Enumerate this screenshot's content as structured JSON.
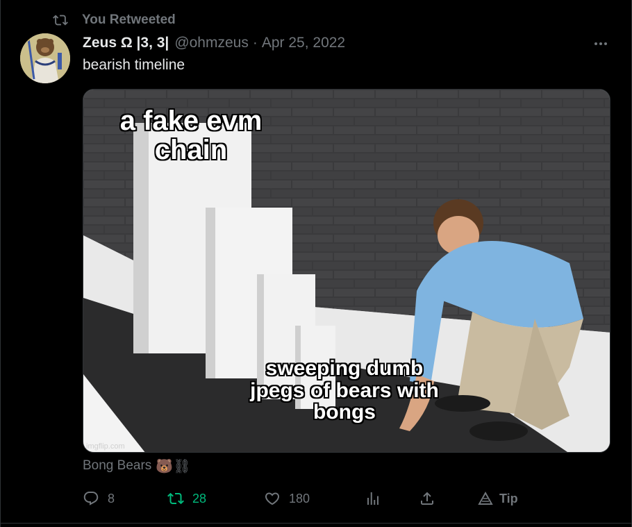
{
  "retweet_banner": {
    "text": "You Retweeted",
    "icon": "retweet-icon"
  },
  "tweet": {
    "author": {
      "display_name": "Zeus Ω |3, 3|",
      "handle": "@ohmzeus",
      "avatar_icon": "zeus-avatar"
    },
    "separator": "·",
    "date": "Apr 25, 2022",
    "text": "bearish timeline",
    "media": {
      "caption_top": "a fake evm chain",
      "caption_bottom": "sweeping dumb jpegs of bears with bongs",
      "watermark": "imgflip.com"
    },
    "media_caption": {
      "text": "Bong Bears",
      "emoji": "🐻⛓"
    }
  },
  "actions": {
    "reply": {
      "count": "8",
      "icon": "reply-icon"
    },
    "retweet": {
      "count": "28",
      "icon": "retweet-icon",
      "active_color": "#00ba7c"
    },
    "like": {
      "count": "180",
      "icon": "heart-icon"
    },
    "views": {
      "icon": "analytics-icon"
    },
    "share": {
      "icon": "share-icon"
    },
    "tip": {
      "label": "Tip",
      "icon": "tip-icon"
    }
  },
  "colors": {
    "background": "#000000",
    "text_primary": "#e7e9ea",
    "text_secondary": "#71767b",
    "border": "#2f3336"
  }
}
